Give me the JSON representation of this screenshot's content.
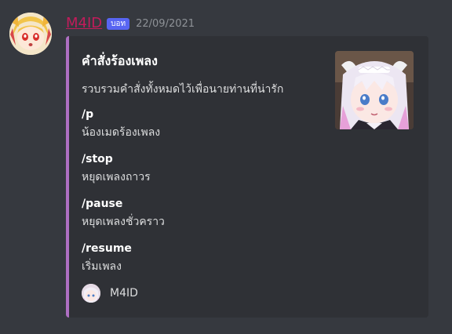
{
  "message": {
    "author": "M4ID",
    "bot_tag": "บอท",
    "timestamp": "22/09/2021",
    "accent_color": "#ae6fc2",
    "username_color": "#c21c5b",
    "bot_tag_color": "#5865f2",
    "avatar_icon": "anime-avatar-icon",
    "embed": {
      "title": "คำสั่งร้องเพลง",
      "description": "รวบรวมคำสั่งทั้งหมดไว้เพื่อนายท่านที่น่ารัก",
      "fields": [
        {
          "name": "/p",
          "value": "น้องเมดร้องเพลง"
        },
        {
          "name": "/stop",
          "value": "หยุดเพลงถาวร"
        },
        {
          "name": "/pause",
          "value": "หยุดเพลงชั่วคราว"
        },
        {
          "name": "/resume",
          "value": "เริ่มเพลง"
        }
      ],
      "thumbnail_icon": "anime-thumbnail-image",
      "footer": {
        "text": "M4ID",
        "icon": "footer-avatar-icon"
      }
    }
  }
}
